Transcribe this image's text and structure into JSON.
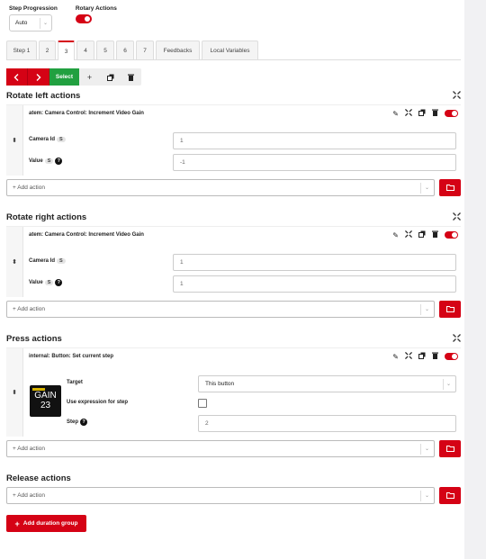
{
  "options": {
    "step_progression_label": "Step Progression",
    "step_progression_value": "Auto",
    "rotary_actions_label": "Rotary Actions",
    "rotary_actions_enabled": true
  },
  "tabs": [
    "Step 1",
    "2",
    "3",
    "4",
    "5",
    "6",
    "7",
    "Feedbacks",
    "Local Variables"
  ],
  "active_tab": "3",
  "toolbar": {
    "select_label": "Select",
    "add": "+",
    "copy": "copy-icon",
    "delete": "trash-icon"
  },
  "sections": {
    "rotate_left": {
      "title": "Rotate left actions",
      "action_name": "atem: Camera Control: Increment Video Gain",
      "fields": [
        {
          "label": "Camera Id",
          "badge": "S",
          "value": "1"
        },
        {
          "label": "Value",
          "badge": "S",
          "help": "?",
          "value": "-1"
        }
      ],
      "add_placeholder": "+ Add action"
    },
    "rotate_right": {
      "title": "Rotate right actions",
      "action_name": "atem: Camera Control: Increment Video Gain",
      "fields": [
        {
          "label": "Camera Id",
          "badge": "S",
          "value": "1"
        },
        {
          "label": "Value",
          "badge": "S",
          "help": "?",
          "value": "1"
        }
      ],
      "add_placeholder": "+ Add action"
    },
    "press": {
      "title": "Press actions",
      "action_name": "internal: Button: Set current step",
      "button_preview": {
        "line1": "GAIN",
        "line2": "23"
      },
      "target_label": "Target",
      "target_value": "This button",
      "use_expression_label": "Use expression for step",
      "use_expression_checked": false,
      "step_label": "Step",
      "step_help": "?",
      "step_value": "2",
      "add_placeholder": "+ Add action"
    },
    "release": {
      "title": "Release actions",
      "add_placeholder": "+ Add action"
    }
  },
  "duration_group_label": "Add duration group",
  "colors": {
    "accent": "#d50215",
    "select_green": "#21a040"
  }
}
